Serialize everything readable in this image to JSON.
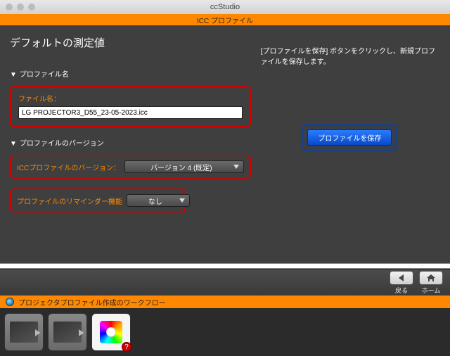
{
  "window": {
    "title": "ccStudio"
  },
  "subheader": {
    "title": "ICC プロファイル"
  },
  "page": {
    "title": "デフォルトの測定値"
  },
  "sections": {
    "profile_name": {
      "header": "プロファイル名",
      "file_label": "ファイル名：",
      "file_value": "LG PROJECTOR3_D55_23-05-2023.icc"
    },
    "profile_version": {
      "header": "プロファイルのバージョン",
      "version_label": "ICCプロファイルのバージョン：",
      "version_value": "バージョン 4 (既定)",
      "reminder_label": "プロファイルのリマインダー機能",
      "reminder_value": "なし"
    }
  },
  "right_panel": {
    "instructions": "[プロファイルを保存] ボタンをクリックし、新規プロファイルを保存します。",
    "save_label": "プロファイルを保存"
  },
  "nav": {
    "back": "戻る",
    "home": "ホーム"
  },
  "workflow": {
    "title": "プロジェクタプロファイル作成のワークフロー",
    "badge": "?"
  }
}
